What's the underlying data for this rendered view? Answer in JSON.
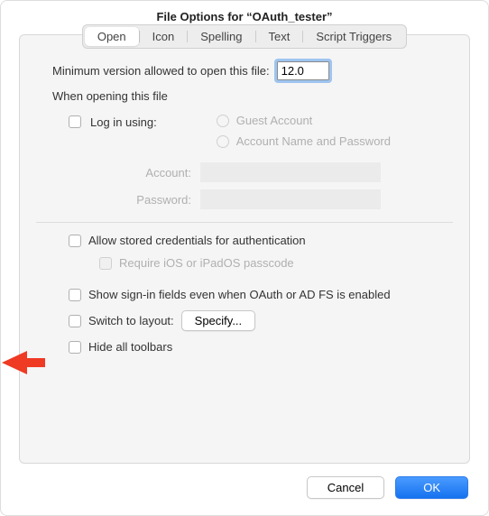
{
  "window": {
    "title": "File Options for “OAuth_tester”"
  },
  "tabs": {
    "open": "Open",
    "icon": "Icon",
    "spelling": "Spelling",
    "text": "Text",
    "script_triggers": "Script Triggers"
  },
  "open_panel": {
    "min_version_label": "Minimum version allowed to open this file:",
    "min_version_value": "12.0",
    "when_opening_label": "When opening this file",
    "log_in_using": "Log in using:",
    "guest_account": "Guest Account",
    "account_name_and_password": "Account Name and Password",
    "account_label": "Account:",
    "password_label": "Password:",
    "allow_stored_credentials": "Allow stored credentials for authentication",
    "require_passcode": "Require iOS or iPadOS passcode",
    "show_signin_fields": "Show sign-in fields even when OAuth or AD FS is enabled",
    "switch_to_layout": "Switch to layout:",
    "specify_btn": "Specify...",
    "hide_all_toolbars": "Hide all toolbars"
  },
  "buttons": {
    "cancel": "Cancel",
    "ok": "OK"
  }
}
